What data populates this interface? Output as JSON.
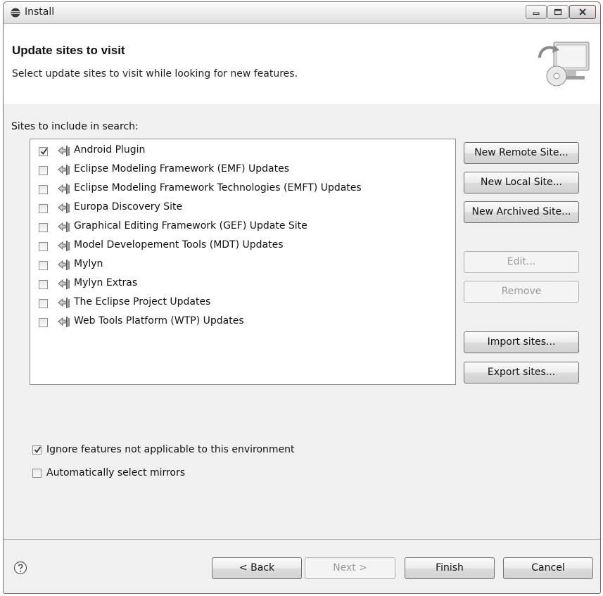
{
  "window": {
    "title": "Install"
  },
  "banner": {
    "title": "Update sites to visit",
    "description": "Select update sites to visit while looking for new features."
  },
  "sites_label": "Sites to include in search:",
  "sites": [
    {
      "label": "Android Plugin",
      "checked": true
    },
    {
      "label": "Eclipse Modeling Framework (EMF) Updates",
      "checked": false
    },
    {
      "label": "Eclipse Modeling Framework Technologies (EMFT) Updates",
      "checked": false
    },
    {
      "label": "Europa Discovery Site",
      "checked": false
    },
    {
      "label": "Graphical Editing Framework (GEF) Update Site",
      "checked": false
    },
    {
      "label": "Model Developement Tools (MDT) Updates",
      "checked": false
    },
    {
      "label": "Mylyn",
      "checked": false
    },
    {
      "label": "Mylyn Extras",
      "checked": false
    },
    {
      "label": "The Eclipse Project Updates",
      "checked": false
    },
    {
      "label": "Web Tools Platform (WTP) Updates",
      "checked": false
    }
  ],
  "side_buttons": {
    "new_remote": "New Remote Site...",
    "new_local": "New Local Site...",
    "new_archived": "New Archived Site...",
    "edit": "Edit...",
    "remove": "Remove",
    "import": "Import sites...",
    "export": "Export sites..."
  },
  "options": {
    "ignore_features": {
      "label": "Ignore features not applicable to this environment",
      "checked": true
    },
    "auto_mirrors": {
      "label": "Automatically select mirrors",
      "checked": false
    }
  },
  "footer": {
    "back": "< Back",
    "next": "Next >",
    "finish": "Finish",
    "cancel": "Cancel"
  }
}
